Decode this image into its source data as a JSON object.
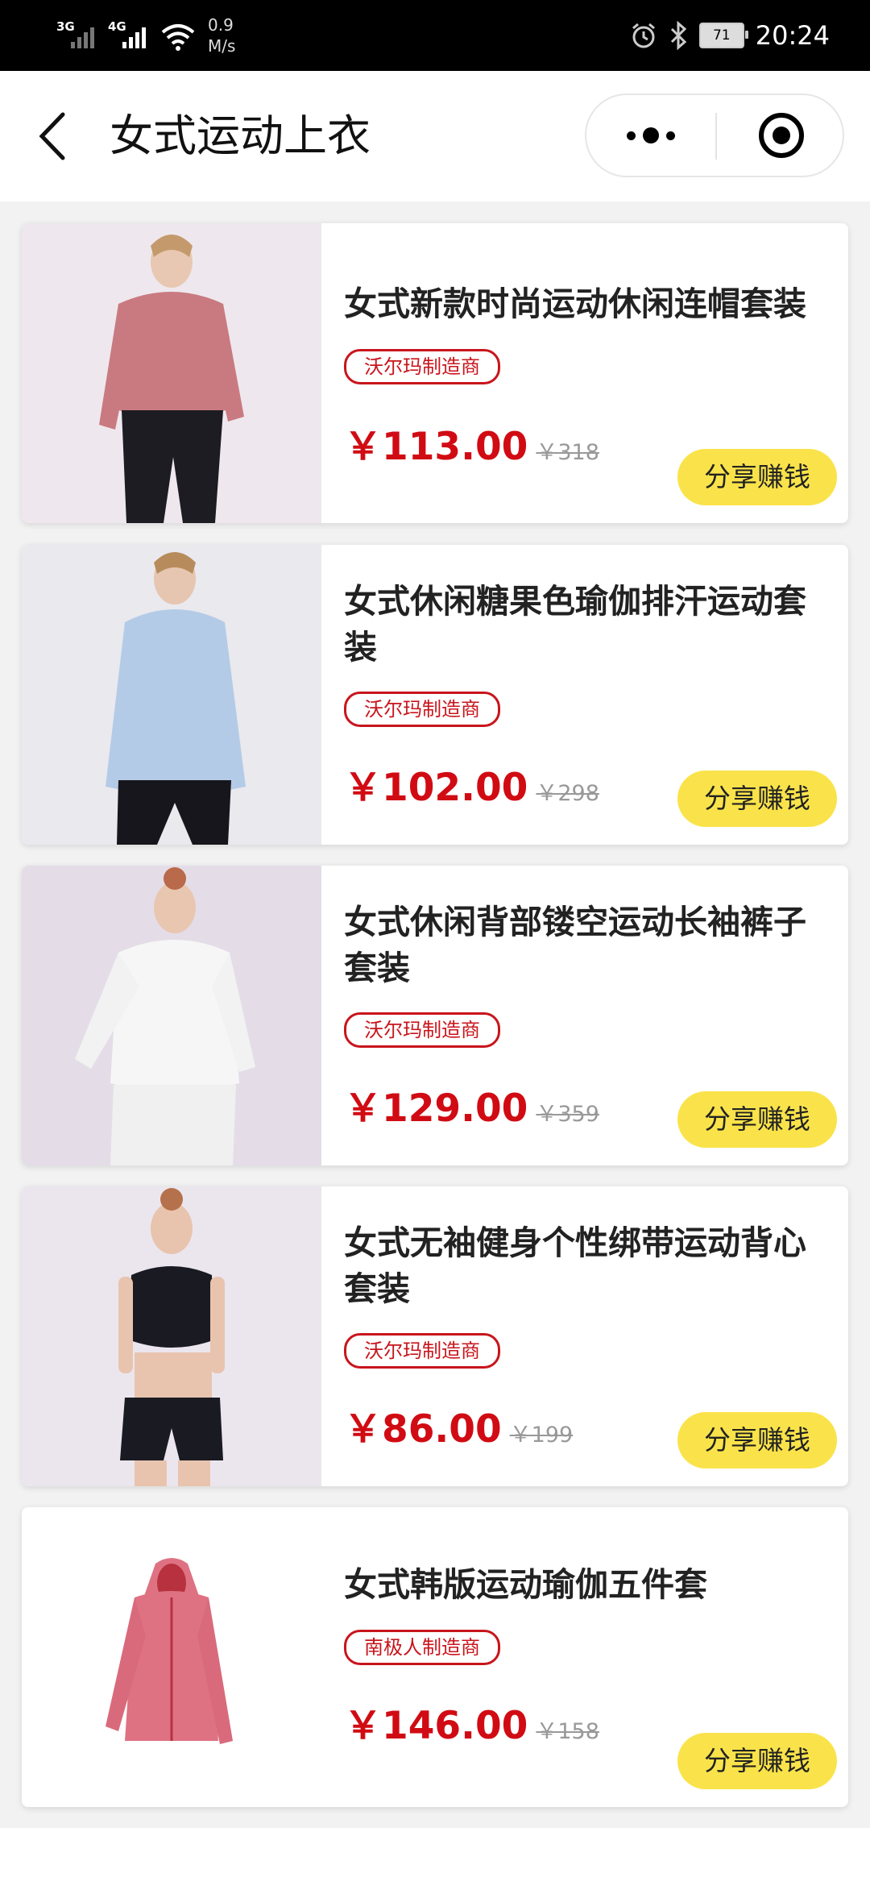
{
  "status": {
    "net1": "3G",
    "net2": "4G",
    "speed_value": "0.9",
    "speed_unit": "M/s",
    "battery": "71",
    "time": "20:24"
  },
  "nav": {
    "title": "女式运动上衣"
  },
  "products": [
    {
      "title": "女式新款时尚运动休闲连帽套装",
      "vendor": "沃尔玛制造商",
      "price": "￥113.00",
      "original_price": "￥318",
      "action": "分享赚钱",
      "garment_color": "#c97a80"
    },
    {
      "title": "女式休闲糖果色瑜伽排汗运动套装",
      "vendor": "沃尔玛制造商",
      "price": "￥102.00",
      "original_price": "￥298",
      "action": "分享赚钱",
      "garment_color": "#b4cbe7"
    },
    {
      "title": "女式休闲背部镂空运动长袖裤子套装",
      "vendor": "沃尔玛制造商",
      "price": "￥129.00",
      "original_price": "￥359",
      "action": "分享赚钱",
      "garment_color": "#f4f4f4"
    },
    {
      "title": "女式无袖健身个性绑带运动背心套装",
      "vendor": "沃尔玛制造商",
      "price": "￥86.00",
      "original_price": "￥199",
      "action": "分享赚钱",
      "garment_color": "#1a1a22"
    },
    {
      "title": "女式韩版运动瑜伽五件套",
      "vendor": "南极人制造商",
      "price": "￥146.00",
      "original_price": "￥158",
      "action": "分享赚钱",
      "garment_color": "#de7283"
    }
  ]
}
